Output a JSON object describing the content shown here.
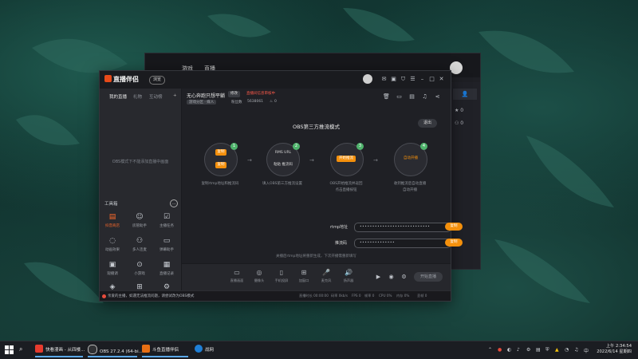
{
  "obs": {
    "nav": [
      "游戏",
      "直播"
    ],
    "side_counts": [
      "0",
      "0",
      "0"
    ]
  },
  "app": {
    "title": "直播伴侣",
    "version": "浏览",
    "left_tabs": [
      "我的直播",
      "礼物",
      "互动榜"
    ],
    "left_empty": "OBS模式下不能添加直播中画面",
    "tools_title": "工具箱",
    "tools": [
      {
        "label": "抖音商店",
        "icon": "shop-icon"
      },
      {
        "label": "房管助手",
        "icon": "manager-icon"
      },
      {
        "label": "主播任务",
        "icon": "task-icon"
      },
      {
        "label": "动画效果",
        "icon": "effect-icon"
      },
      {
        "label": "多人连麦",
        "icon": "link-icon"
      },
      {
        "label": "弹幕助手",
        "icon": "danmaku-icon"
      },
      {
        "label": "观播调",
        "icon": "view-icon"
      },
      {
        "label": "小游戏",
        "icon": "game-icon"
      },
      {
        "label": "直播记录",
        "icon": "record-icon"
      },
      {
        "label": "更多",
        "icon": "more-icon"
      },
      {
        "label": "新玩法",
        "icon": "new-icon"
      },
      {
        "label": "设置",
        "icon": "settings-icon"
      }
    ],
    "room": {
      "name": "无心奔跑只想平躺",
      "tag": "修改",
      "warning": "直播间信息审核中",
      "category": "游戏分区 · 媒人",
      "fans_label": "粉丝数",
      "fans": "5638061",
      "likes": "0"
    },
    "mode_title": "OBS第三方推流模式",
    "exit": "退出",
    "steps": [
      {
        "num": "1",
        "a": "复制",
        "b": "复制",
        "cap1": "复制rtmp地址和推流码",
        "cap2": ""
      },
      {
        "num": "2",
        "a": "RMS URL",
        "b": "粘贴 推流码",
        "cap1": "填入OBS第三方推流设置",
        "cap2": ""
      },
      {
        "num": "3",
        "a": "开始推流",
        "b": "",
        "cap1": "OBS开始推流并返回",
        "cap2": "点击直播按钮"
      },
      {
        "num": "4",
        "a": "自动开播",
        "b": "",
        "cap1": "收到推流后自动直播",
        "cap2": "自动开播"
      }
    ],
    "fields": [
      {
        "label": "rtmp地址",
        "value": "••••••••••••••••••••••••••••",
        "button": "复制"
      },
      {
        "label": "推流码",
        "value": "••••••••••••••",
        "button": "复制"
      }
    ],
    "hint": "关播后rtmp地址将重新生成，下次开播需重新填写",
    "bottom": [
      "直播画面",
      "摄像头",
      "手机投屏",
      "加窗口",
      "麦克风",
      "扬声器"
    ],
    "start_live": "开始直播",
    "status_notice": "亲爱的主播，如遇无法推流问题，请尝试改为OBS模式",
    "status_right": [
      "直播时长 00:00:00",
      "码率 0kb/s",
      "FPS 0",
      "帧率 0",
      "CPU 0%",
      "内存 0%",
      "丢帧 0"
    ]
  },
  "taskbar": {
    "items": [
      {
        "label": "快看漫画 - 从四楼...",
        "color": "#e63b2e"
      },
      {
        "label": "OBS 27.2.4 (64-bi...",
        "color": "#303134"
      },
      {
        "label": "斗鱼直播伴侣",
        "color": "#e86f14"
      },
      {
        "label": "战网",
        "color": "#1f7fd6"
      }
    ],
    "time": "上午 2:34:54",
    "date": "2022/6/14 星期四"
  }
}
